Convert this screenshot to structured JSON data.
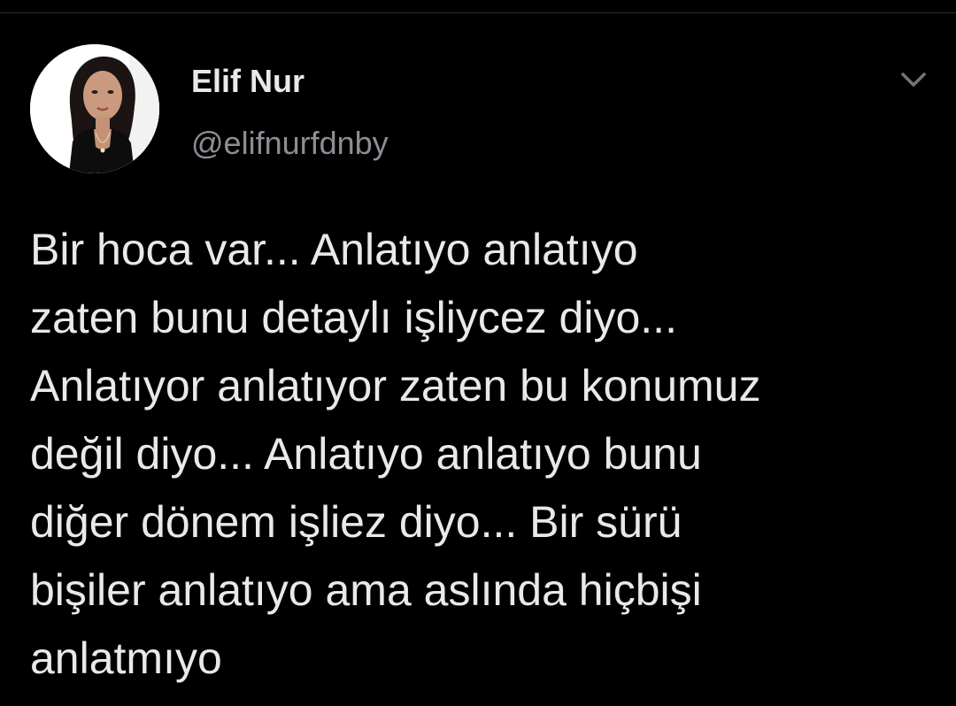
{
  "user": {
    "display_name": "Elif Nur",
    "handle": "@elifnurfdnby",
    "avatar_icon": "profile-photo"
  },
  "tweet": {
    "lines": [
      "Bir hoca var... Anlatıyo anlatıyo",
      "zaten bunu detaylı işliycez diyo...",
      "Anlatıyor anlatıyor zaten bu konumuz",
      "değil diyo... Anlatıyo anlatıyo bunu",
      "diğer dönem işliez diyo... Bir sürü",
      "bişiler anlatıyo ama aslında hiçbişi",
      "anlatmıyo"
    ]
  },
  "menu": {
    "icon": "chevron-down-icon"
  },
  "colors": {
    "background": "#000000",
    "text_primary": "#e7e9ea",
    "text_secondary": "#8b8f94"
  }
}
